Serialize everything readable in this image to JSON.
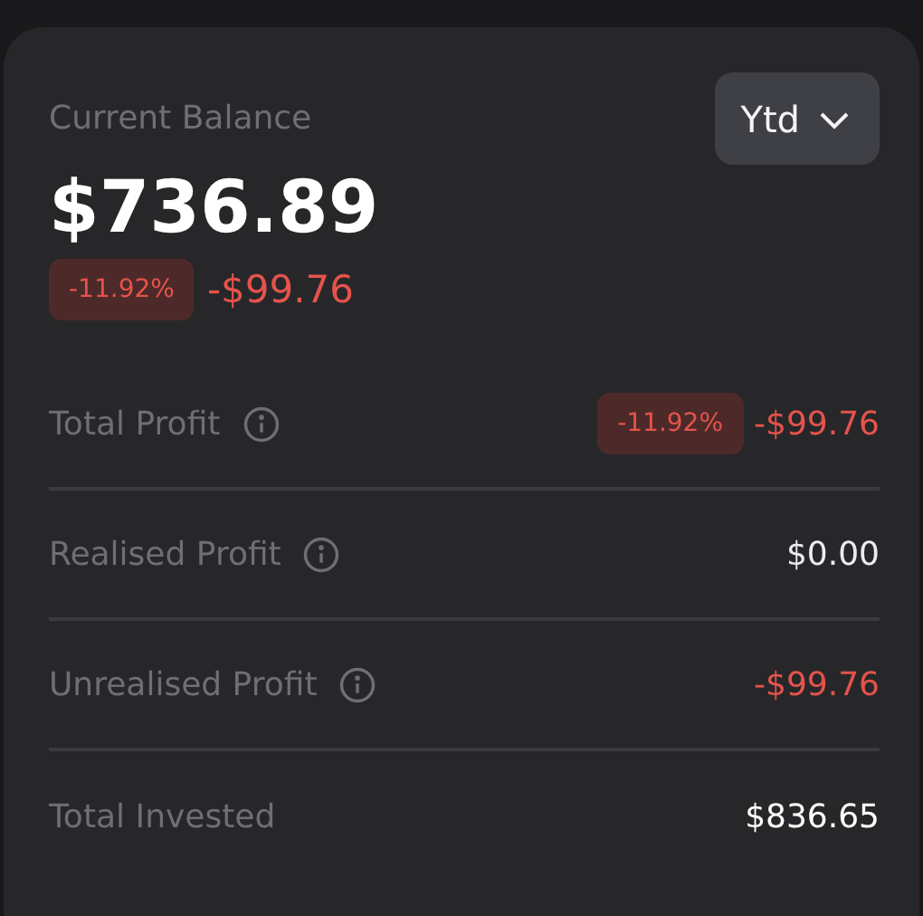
{
  "balance": {
    "label": "Current Balance",
    "amount": "$736.89",
    "change_percent": "-11.92%",
    "change_amount": "-$99.76",
    "color": "#e5534b"
  },
  "period_dropdown": {
    "label": "Ytd"
  },
  "rows": [
    {
      "label": "Total Profit",
      "info": true,
      "badge": "-11.92%",
      "value": "-$99.76",
      "color": "#e5534b"
    },
    {
      "label": "Realised Profit",
      "info": true,
      "value": "$0.00",
      "color": "#ececef"
    },
    {
      "label": "Unrealised Profit",
      "info": true,
      "value": "-$99.76",
      "color": "#e5534b"
    },
    {
      "label": "Total Invested",
      "info": false,
      "value": "$836.65",
      "color": "#ffffff"
    }
  ]
}
